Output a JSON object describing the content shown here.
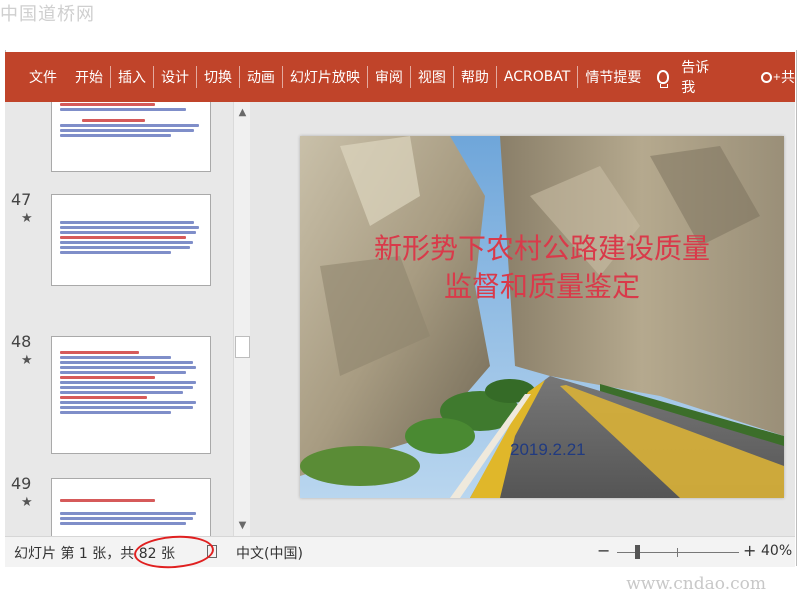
{
  "watermarks": {
    "top": "中国道桥网",
    "bottom": "www.cndao.com"
  },
  "ribbon": {
    "tabs": [
      "文件",
      "开始",
      "插入",
      "设计",
      "切换",
      "动画",
      "幻灯片放映",
      "审阅",
      "视图",
      "帮助",
      "ACROBAT",
      "情节提要"
    ],
    "tell_me": "告诉我",
    "share": "共"
  },
  "slides_panel": {
    "thumbnails": [
      {
        "number": "",
        "star": ""
      },
      {
        "number": "47",
        "star": "★"
      },
      {
        "number": "48",
        "star": "★"
      },
      {
        "number": "49",
        "star": "★"
      }
    ]
  },
  "slide": {
    "title_line1": "新形势下农村公路建设质量",
    "title_line2": "监督和质量鉴定",
    "date": "2019.2.21"
  },
  "status": {
    "slide_info": "幻灯片 第 1 张，共 82 张",
    "language": "中文(中国)",
    "zoom_minus": "−",
    "zoom_plus": "+",
    "zoom_level": "40%",
    "zoom_percent": 40
  },
  "colors": {
    "ribbon": "#c0442a",
    "title": "#d93a4a",
    "date": "#203a80",
    "annotation": "#e02020"
  }
}
